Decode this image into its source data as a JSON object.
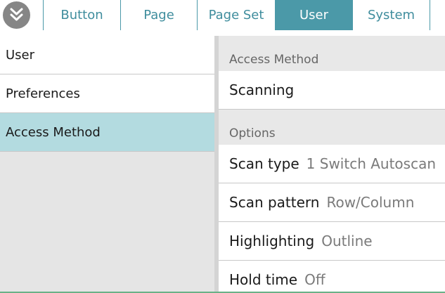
{
  "tabs": [
    {
      "label": "Button",
      "active": false
    },
    {
      "label": "Page",
      "active": false
    },
    {
      "label": "Page Set",
      "active": false
    },
    {
      "label": "User",
      "active": true
    },
    {
      "label": "System",
      "active": false
    }
  ],
  "sidebar": {
    "items": [
      {
        "label": "User",
        "selected": false
      },
      {
        "label": "Preferences",
        "selected": false
      },
      {
        "label": "Access Method",
        "selected": true
      }
    ]
  },
  "content": {
    "access_method_header": "Access Method",
    "access_method_value": "Scanning",
    "options_header": "Options",
    "options": [
      {
        "label": "Scan type",
        "value": "1 Switch Autoscan"
      },
      {
        "label": "Scan pattern",
        "value": "Row/Column"
      },
      {
        "label": "Highlighting",
        "value": "Outline"
      },
      {
        "label": "Hold time",
        "value": "Off"
      }
    ]
  },
  "colors": {
    "accent": "#4b99a8",
    "selected_item": "#b3dbe0"
  },
  "icons": {
    "collapse": "double-chevron-down-icon"
  }
}
